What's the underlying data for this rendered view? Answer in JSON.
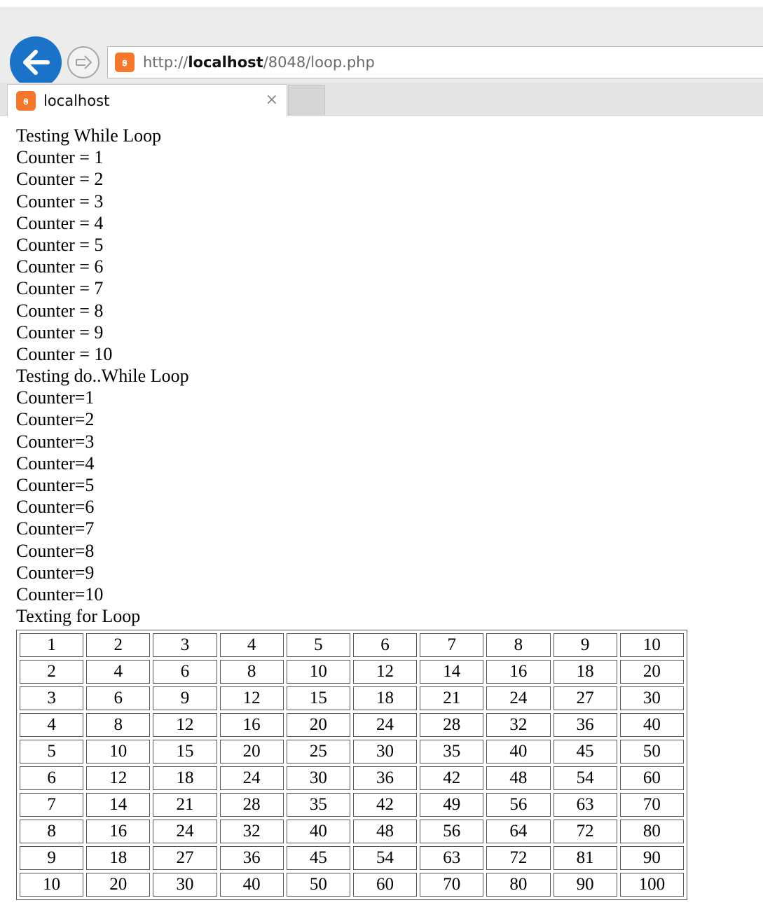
{
  "browser": {
    "url_prefix": "http://",
    "url_host": "localhost",
    "url_path": "/8048/loop.php",
    "tab_title": "localhost",
    "tab_close": "×",
    "favicon_glyph": "ꭶ",
    "accent_color": "#1a73c8",
    "favicon_color": "#f4772b"
  },
  "page": {
    "while_heading": "Testing While Loop",
    "while_lines": [
      "Counter = 1",
      "Counter = 2",
      "Counter = 3",
      "Counter = 4",
      "Counter = 5",
      "Counter = 6",
      "Counter = 7",
      "Counter = 8",
      "Counter = 9",
      "Counter = 10"
    ],
    "dowhile_heading": "Testing do..While Loop",
    "dowhile_lines": [
      "Counter=1",
      "Counter=2",
      "Counter=3",
      "Counter=4",
      "Counter=5",
      "Counter=6",
      "Counter=7",
      "Counter=8",
      "Counter=9",
      "Counter=10"
    ],
    "for_heading": "Texting for Loop",
    "table": [
      [
        "1",
        "2",
        "3",
        "4",
        "5",
        "6",
        "7",
        "8",
        "9",
        "10"
      ],
      [
        "2",
        "4",
        "6",
        "8",
        "10",
        "12",
        "14",
        "16",
        "18",
        "20"
      ],
      [
        "3",
        "6",
        "9",
        "12",
        "15",
        "18",
        "21",
        "24",
        "27",
        "30"
      ],
      [
        "4",
        "8",
        "12",
        "16",
        "20",
        "24",
        "28",
        "32",
        "36",
        "40"
      ],
      [
        "5",
        "10",
        "15",
        "20",
        "25",
        "30",
        "35",
        "40",
        "45",
        "50"
      ],
      [
        "6",
        "12",
        "18",
        "24",
        "30",
        "36",
        "42",
        "48",
        "54",
        "60"
      ],
      [
        "7",
        "14",
        "21",
        "28",
        "35",
        "42",
        "49",
        "56",
        "63",
        "70"
      ],
      [
        "8",
        "16",
        "24",
        "32",
        "40",
        "48",
        "56",
        "64",
        "72",
        "80"
      ],
      [
        "9",
        "18",
        "27",
        "36",
        "45",
        "54",
        "63",
        "72",
        "81",
        "90"
      ],
      [
        "10",
        "20",
        "30",
        "40",
        "50",
        "60",
        "70",
        "80",
        "90",
        "100"
      ]
    ]
  }
}
